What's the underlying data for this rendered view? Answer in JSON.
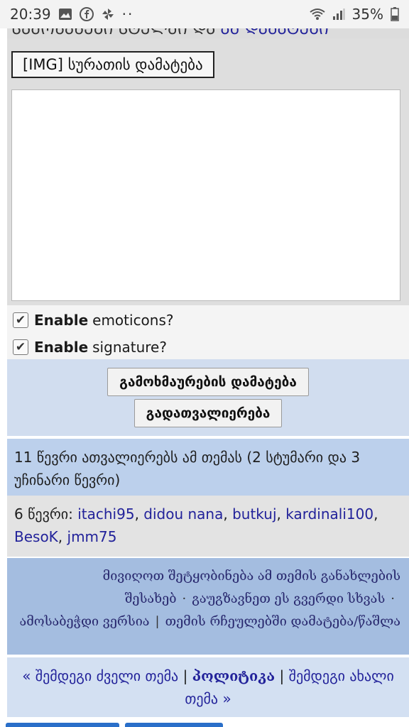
{
  "status_bar": {
    "time": "20:39",
    "battery": "35%",
    "icons": [
      "image-icon",
      "facebook-icon",
      "pinwheel-icon",
      "more-dots-icon",
      "wifi-icon",
      "signal-icon",
      "battery-icon"
    ]
  },
  "cutoff_line": {
    "text": "ᲡᲐᲛᲝᲜᲐᲜᲔᲑᲘ ᲡᲢᲔᲚᲨᲘ ᲓᲐ ",
    "link": "ᲐᲛ ᲓᲐᲛᲐᲢᲔᲑᲘ"
  },
  "editor": {
    "img_button": "[IMG] სურათის დამატება",
    "textarea_value": ""
  },
  "options": {
    "emoticons_bold": "Enable",
    "emoticons_rest": "emoticons?",
    "signature_bold": "Enable",
    "signature_rest": "signature?"
  },
  "buttons": {
    "submit": "გამოხმაურების დამატება",
    "preview": "გადათვალიერება"
  },
  "viewers_text": "11 წევრი ათვალიერებს ამ თემას (2 სტუმარი და 3 უჩინარი წევრი)",
  "members": {
    "prefix": "6 წევრი:",
    "names": [
      "itachi95",
      "didou nana",
      "butkuj",
      "kardinali100",
      "BesoK",
      "jmm75"
    ]
  },
  "tools": {
    "notify": "მივიღოთ შეტყობინება ამ თემის განახლების შესახებ",
    "send": "გაუგზავნეთ ეს გვერდი სხვას",
    "print": "ამოსაბეჭდი ვერსია",
    "favorites": "თემის რჩეულებში დამატება/წაშლა"
  },
  "nav": {
    "prev": "« შემდეგი ძველი თემა",
    "category": "პოლიტიკა",
    "next": "შემდეგი ახალი თემა »"
  },
  "colors": {
    "accent_link": "#22229a",
    "blue_band": "#bcd0ec",
    "tools_band": "#a4bde0",
    "tab_blue": "#2a6fc9"
  }
}
